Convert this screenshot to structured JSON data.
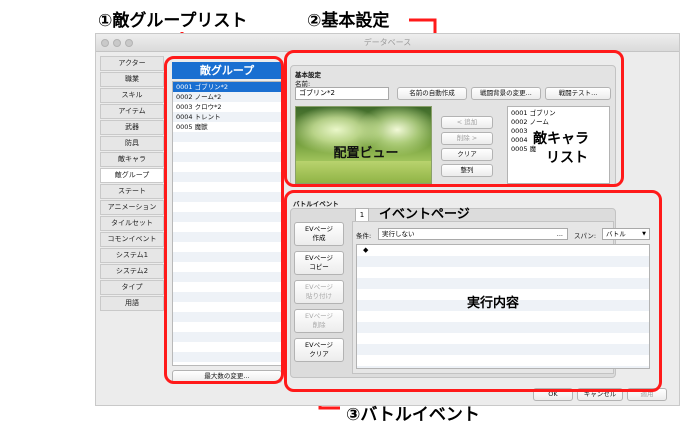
{
  "annotations": {
    "enemy_group_list": "①敵グループリスト",
    "basic_settings": "②基本設定",
    "battle_event": "③バトルイベント",
    "layout_view": "配置ビュー",
    "enemy_chara_list_1": "敵キャラ",
    "enemy_chara_list_2": "リスト",
    "event_page": "イベントページ",
    "exec_content": "実行内容"
  },
  "window": {
    "title": "データベース"
  },
  "sidebar": {
    "items": [
      "アクター",
      "職業",
      "スキル",
      "アイテム",
      "武器",
      "防具",
      "敵キャラ",
      "敵グループ",
      "ステート",
      "アニメーション",
      "タイルセット",
      "コモンイベント",
      "システム1",
      "システム2",
      "タイプ",
      "用語"
    ],
    "active": "敵グループ"
  },
  "enemy_groups": {
    "header": "敵グループ",
    "rows": [
      "0001 ゴブリン*2",
      "0002 ノーム*2",
      "0003 クロウ*2",
      "0004 トレント",
      "0005 魔獣"
    ],
    "max_button": "最大数の変更..."
  },
  "basic": {
    "section_label": "基本設定",
    "name_label": "名前:",
    "name_value": "ゴブリン*2",
    "auto_name_button": "名前の自動作成",
    "change_bg_button": "戦闘背景の変更...",
    "battle_test_button": "戦闘テスト...",
    "add_button": "< 追加",
    "remove_button": "削除 >",
    "clear_button": "クリア",
    "align_button": "整列",
    "enemy_list": [
      "0001 ゴブリン",
      "0002 ノーム",
      "0003",
      "0004",
      "0005 魔"
    ]
  },
  "battle_event": {
    "section_label": "バトルイベント",
    "tab": "1",
    "cond_label": "条件:",
    "cond_value": "実行しない",
    "cond_more": "...",
    "span_label": "スパン:",
    "span_value": "バトル",
    "span_arrow": "▼",
    "first_line": "◆",
    "buttons": [
      {
        "l1": "EVページ",
        "l2": "作成"
      },
      {
        "l1": "EVページ",
        "l2": "コピー"
      },
      {
        "l1": "EVページ",
        "l2": "貼り付け"
      },
      {
        "l1": "EVページ",
        "l2": "削除"
      },
      {
        "l1": "EVページ",
        "l2": "クリア"
      }
    ]
  },
  "footer": {
    "ok": "OK",
    "cancel": "キャンセル",
    "apply": "適用"
  }
}
